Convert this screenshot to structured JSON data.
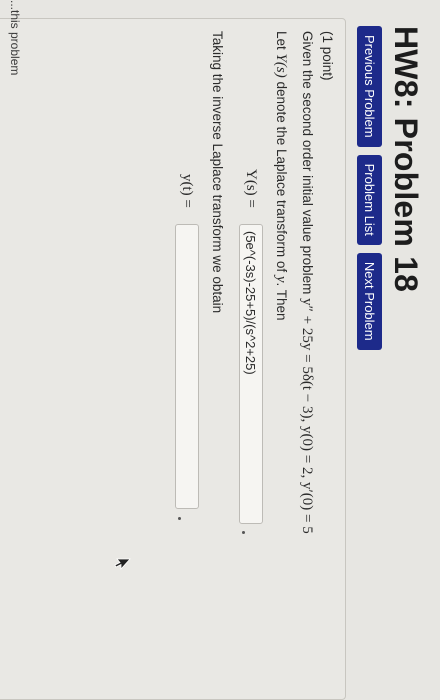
{
  "page": {
    "title": "HW8: Problem 18"
  },
  "nav": {
    "previous": "Previous Problem",
    "list": "Problem List",
    "next": "Next Problem"
  },
  "problem": {
    "points": "(1 point)",
    "statement_prefix": "Given the second order initial value problem ",
    "equation": "y″ + 25y = 5δ(t − 3),  y(0) = 2,  y′(0) = 5",
    "let_line_prefix": "Let ",
    "let_symbol": "Y(s)",
    "let_line_mid": " denote the Laplace transform of ",
    "let_var": "y",
    "let_line_suffix": ". Then",
    "Y_label": "Y(s) =",
    "Y_answer": "(5e^(-3s)-25+5)/(s^2+25)",
    "inverse_text": "Taking the inverse Laplace transform we obtain",
    "y_label": "y(t) =",
    "y_answer": ""
  },
  "footer": {
    "cutoff_text": "...this problem"
  }
}
